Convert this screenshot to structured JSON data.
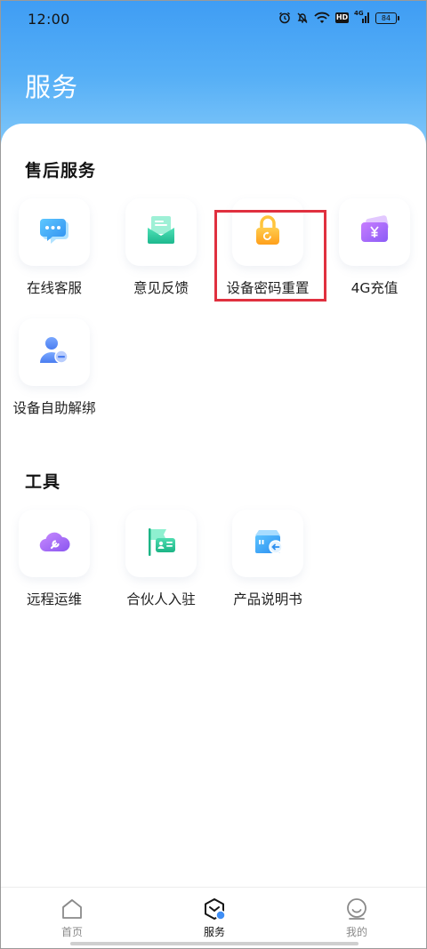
{
  "status_bar": {
    "time": "12:00",
    "hd": "HD",
    "network": "4G",
    "battery": "84",
    "icons": [
      "alarm-icon",
      "mute-icon",
      "wifi-icon",
      "hd-icon",
      "4g-signal-icon",
      "battery-icon"
    ]
  },
  "header": {
    "title": "服务",
    "gradient_top": "#3f9df4",
    "gradient_bottom": "#8fd0fb"
  },
  "sections": {
    "after_sales": {
      "title": "售后服务",
      "items": [
        {
          "label": "在线客服",
          "icon": "chat-bubbles-icon"
        },
        {
          "label": "意见反馈",
          "icon": "feedback-envelope-icon"
        },
        {
          "label": "设备密码重置",
          "icon": "lock-reset-icon"
        },
        {
          "label": "4G充值",
          "icon": "wallet-yen-icon"
        },
        {
          "label": "设备自助解绑",
          "icon": "user-unbind-icon"
        }
      ]
    },
    "tools": {
      "title": "工具",
      "items": [
        {
          "label": "远程运维",
          "icon": "cloud-wrench-icon"
        },
        {
          "label": "合伙人入驻",
          "icon": "flag-card-icon"
        },
        {
          "label": "产品说明书",
          "icon": "manual-box-icon"
        }
      ]
    }
  },
  "highlight_color": "#e0303f",
  "bottom_nav": {
    "items": [
      {
        "label": "首页",
        "icon": "home-icon"
      },
      {
        "label": "服务",
        "icon": "service-box-icon",
        "active": true
      },
      {
        "label": "我的",
        "icon": "profile-smile-icon"
      }
    ]
  }
}
